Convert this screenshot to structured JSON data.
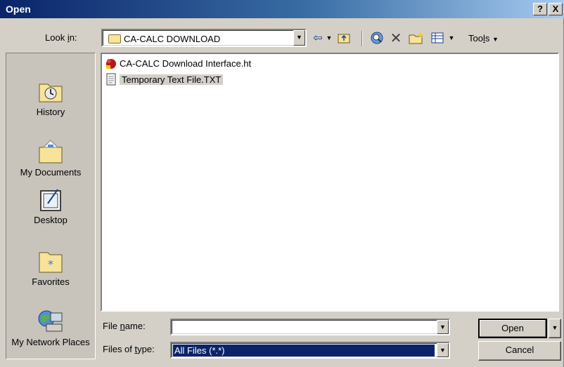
{
  "window": {
    "title": "Open",
    "help_label": "?",
    "close_label": "X"
  },
  "lookin": {
    "label": "Look in:",
    "access_key": "i",
    "value": "CA-CALC DOWNLOAD"
  },
  "toolbar": {
    "tools_label": "Tools",
    "tools_access_key": "l"
  },
  "places": [
    {
      "label": "History",
      "icon": "history-icon"
    },
    {
      "label": "My Documents",
      "icon": "my-documents-icon"
    },
    {
      "label": "Desktop",
      "icon": "desktop-icon"
    },
    {
      "label": "Favorites",
      "icon": "favorites-icon"
    },
    {
      "label": "My Network Places",
      "icon": "network-places-icon"
    }
  ],
  "files": [
    {
      "name": "CA-CALC Download Interface.ht",
      "icon": "html-file-icon",
      "selected": false
    },
    {
      "name": "Temporary Text File.TXT",
      "icon": "text-file-icon",
      "selected": true
    }
  ],
  "filename": {
    "label": "File name:",
    "access_key": "n",
    "value": ""
  },
  "filetype": {
    "label": "Files of type:",
    "access_key": "t",
    "value": "All Files (*.*)"
  },
  "buttons": {
    "open": "Open",
    "cancel": "Cancel"
  }
}
